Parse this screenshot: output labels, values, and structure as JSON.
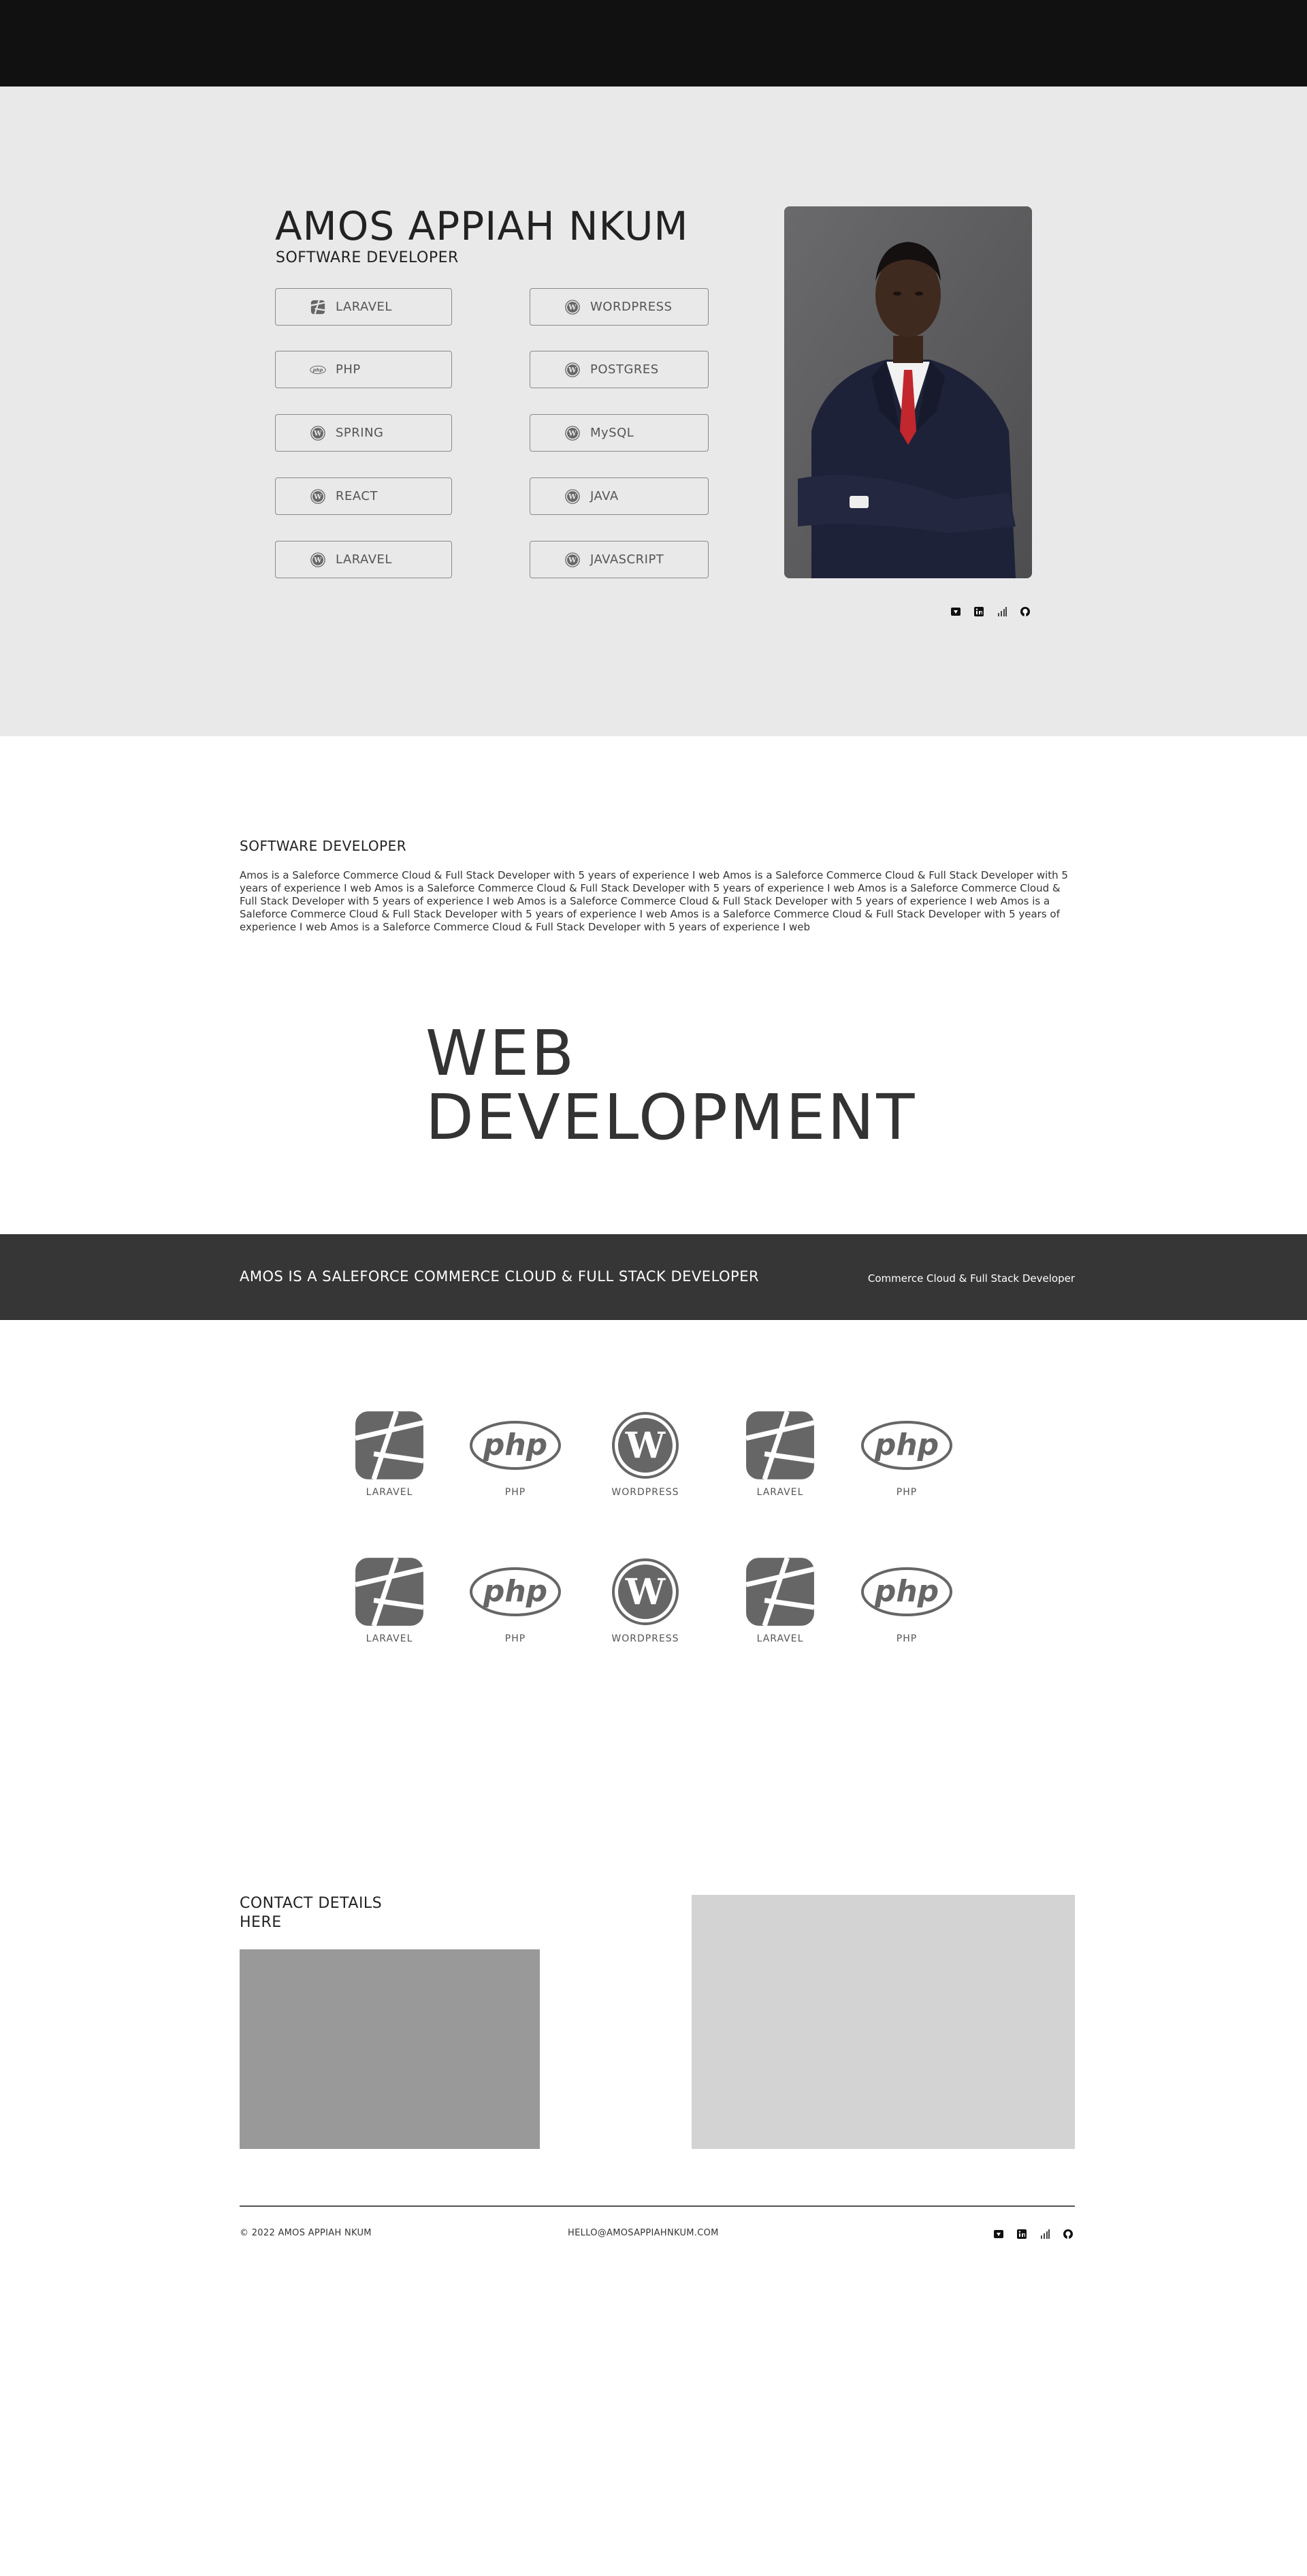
{
  "hero": {
    "name": "AMOS  APPIAH NKUM",
    "role": "SOFTWARE DEVELOPER",
    "skills_left": [
      {
        "label": "LARAVEL",
        "icon": "laravel-icon"
      },
      {
        "label": "PHP",
        "icon": "php-icon"
      },
      {
        "label": "SPRING",
        "icon": "wordpress-icon"
      },
      {
        "label": "REACT",
        "icon": "wordpress-icon"
      },
      {
        "label": "LARAVEL",
        "icon": "wordpress-icon"
      }
    ],
    "skills_right": [
      {
        "label": "WORDPRESS",
        "icon": "wordpress-icon"
      },
      {
        "label": "POSTGRES",
        "icon": "wordpress-icon"
      },
      {
        "label": "MySQL",
        "icon": "wordpress-icon"
      },
      {
        "label": "JAVA",
        "icon": "wordpress-icon"
      },
      {
        "label": "JAVASCRIPT",
        "icon": "wordpress-icon"
      }
    ],
    "social": [
      "bitbucket-icon",
      "linkedin-icon",
      "bar-chart-icon",
      "github-icon"
    ]
  },
  "about": {
    "title": "SOFTWARE DEVELOPER",
    "text": "Amos is a Saleforce Commerce Cloud & Full Stack Developer with 5 years of experience I web   Amos is a Saleforce Commerce Cloud & Full Stack Developer with 5 years of experience I web Amos is a Saleforce Commerce Cloud & Full Stack Developer with 5 years of experience I web Amos is a Saleforce Commerce Cloud & Full Stack Developer with 5 years of experience I web Amos is a Saleforce Commerce Cloud & Full Stack Developer with 5 years of experience I web Amos is a Saleforce Commerce Cloud & Full Stack Developer with 5 years of experience I web Amos is a Saleforce Commerce Cloud & Full Stack Developer with 5 years of experience I web Amos is a Saleforce Commerce Cloud & Full Stack Developer with 5 years of experience I web"
  },
  "services": {
    "heading_line1": "WEB",
    "heading_line2": "DEVELOPMENT"
  },
  "banner": {
    "left": "AMOS IS A SALEFORCE COMMERCE CLOUD & FULL STACK DEVELOPER",
    "right": "Commerce Cloud & Full Stack Developer"
  },
  "tech": {
    "row1": [
      {
        "label": "LARAVEL",
        "icon": "laravel-icon"
      },
      {
        "label": "PHP",
        "icon": "php-icon"
      },
      {
        "label": "WORDPRESS",
        "icon": "wordpress-icon"
      },
      {
        "label": "LARAVEL",
        "icon": "laravel-icon"
      },
      {
        "label": "PHP",
        "icon": "php-icon"
      }
    ],
    "row2": [
      {
        "label": "LARAVEL",
        "icon": "laravel-icon"
      },
      {
        "label": "PHP",
        "icon": "php-icon"
      },
      {
        "label": "WORDPRESS",
        "icon": "wordpress-icon"
      },
      {
        "label": "LARAVEL",
        "icon": "laravel-icon"
      },
      {
        "label": "PHP",
        "icon": "php-icon"
      }
    ]
  },
  "contact": {
    "title": "CONTACT DETAILS HERE"
  },
  "footer": {
    "copyright": "© 2022 AMOS APPIAH NKUM",
    "email": "HELLO@AMOSAPPIAHNKUM.COM",
    "social": [
      "bitbucket-icon",
      "linkedin-icon",
      "bar-chart-icon",
      "github-icon"
    ]
  },
  "colors": {
    "topbar": "#111111",
    "hero_bg": "#e9e9e9",
    "banner_bg": "#363636",
    "icon_gray": "#666666"
  }
}
